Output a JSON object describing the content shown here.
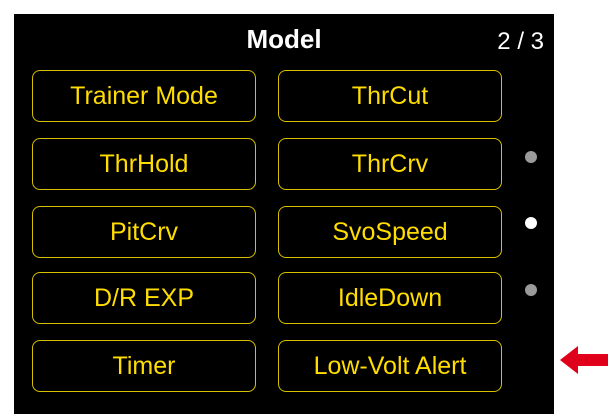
{
  "header": {
    "title": "Model",
    "page_indicator": "2 / 3"
  },
  "buttons": [
    {
      "label": "Trainer Mode"
    },
    {
      "label": "ThrCut"
    },
    {
      "label": "ThrHold"
    },
    {
      "label": "ThrCrv"
    },
    {
      "label": "PitCrv"
    },
    {
      "label": "SvoSpeed"
    },
    {
      "label": "D/R EXP"
    },
    {
      "label": "IdleDown"
    },
    {
      "label": "Timer"
    },
    {
      "label": "Low-Volt Alert"
    }
  ],
  "page_dots": [
    {
      "state": "inactive"
    },
    {
      "state": "active"
    },
    {
      "state": "inactive"
    }
  ],
  "colors": {
    "background": "#000000",
    "button_text": "#ffdd00",
    "button_border": "#d6c000",
    "arrow": "#e0001b"
  },
  "annotation": {
    "icon": "red-arrow-left-icon"
  }
}
